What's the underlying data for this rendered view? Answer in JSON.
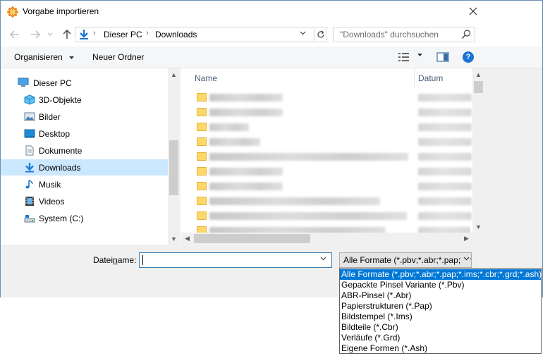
{
  "window": {
    "title": "Vorgabe importieren"
  },
  "address": {
    "crumbs": [
      "Dieser PC",
      "Downloads"
    ],
    "search_placeholder": "\"Downloads\" durchsuchen"
  },
  "toolbar": {
    "organize": "Organisieren",
    "new_folder": "Neuer Ordner"
  },
  "nav": {
    "items": [
      {
        "label": "Dieser PC",
        "icon": "pc-icon"
      },
      {
        "label": "3D-Objekte",
        "icon": "3d-objects-icon"
      },
      {
        "label": "Bilder",
        "icon": "pictures-icon"
      },
      {
        "label": "Desktop",
        "icon": "desktop-icon"
      },
      {
        "label": "Dokumente",
        "icon": "documents-icon"
      },
      {
        "label": "Downloads",
        "icon": "downloads-icon"
      },
      {
        "label": "Musik",
        "icon": "music-icon"
      },
      {
        "label": "Videos",
        "icon": "videos-icon"
      },
      {
        "label": "System (C:)",
        "icon": "drive-icon"
      }
    ],
    "selected": "Downloads"
  },
  "files": {
    "columns": {
      "name": "Name",
      "date": "Datum"
    }
  },
  "bottom": {
    "filename_label_pre": "Datei",
    "filename_label_accel": "n",
    "filename_label_post": "ame:",
    "filename_value": "",
    "filter_value": "Alle Formate (*.pbv;*.abr;*.pap;*.ims;*.cbr;*.grd;*.ash)"
  },
  "filter_options": [
    "Alle Formate (*.pbv;*.abr;*.pap;*.ims;*.cbr;*.grd;*.ash)",
    "Gepackte Pinsel Variante (*.Pbv)",
    "ABR-Pinsel (*.Abr)",
    "Papierstrukturen (*.Pap)",
    "Bildstempel (*.Ims)",
    "Bildteile (*.Cbr)",
    "Verläufe (*.Grd)",
    "Eigene Formen (*.Ash)"
  ],
  "colors": {
    "accent": "#0078d7",
    "selection": "#cce8ff",
    "folder": "#ffd769"
  }
}
